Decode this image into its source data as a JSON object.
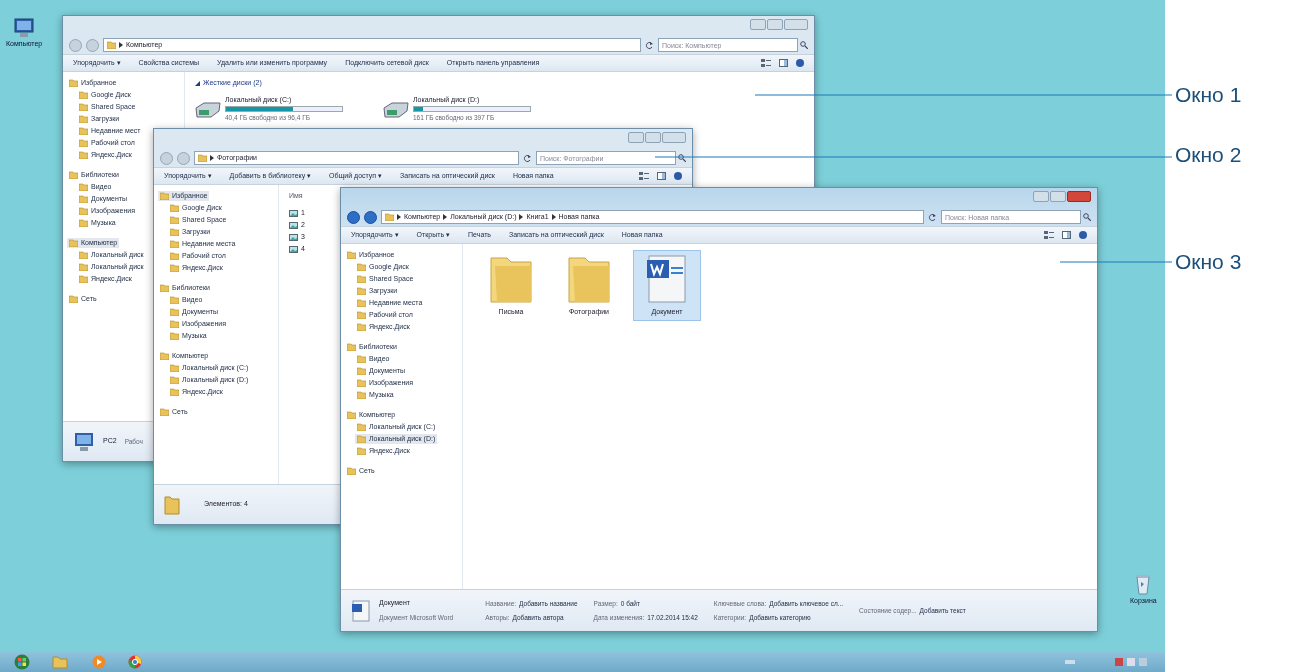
{
  "desktop_icons": [
    {
      "label": "Компьютер"
    },
    {
      "label": "Корзина"
    }
  ],
  "windows": [
    {
      "active": false,
      "crumbs": [
        "Компьютер"
      ],
      "search": {
        "placeholder": "Поиск: Компьютер"
      },
      "toolbar": [
        "Упорядочить ▾",
        "Свойства системы",
        "Удалить или изменить программу",
        "Подключить сетевой диск",
        "Открыть панель управления"
      ],
      "nav": [
        {
          "label": "Избранное",
          "selected": false,
          "children": [
            {
              "label": "Google Диск",
              "selected": false
            },
            {
              "label": "Shared Space",
              "selected": false
            },
            {
              "label": "Загрузки",
              "selected": false
            },
            {
              "label": "Недавние мест",
              "selected": false
            },
            {
              "label": "Рабочий стол",
              "selected": false
            },
            {
              "label": "Яндекс.Диск",
              "selected": false
            }
          ]
        },
        {
          "label": "Библиотеки",
          "selected": false,
          "children": [
            {
              "label": "Видео",
              "selected": false
            },
            {
              "label": "Документы",
              "selected": false
            },
            {
              "label": "Изображения",
              "selected": false
            },
            {
              "label": "Музыка",
              "selected": false
            }
          ]
        },
        {
          "label": "Компьютер",
          "selected": true,
          "children": [
            {
              "label": "Локальный диск",
              "selected": false
            },
            {
              "label": "Локальный диск",
              "selected": false
            },
            {
              "label": "Яндекс.Диск",
              "selected": false
            }
          ]
        },
        {
          "label": "Сеть",
          "selected": false
        }
      ],
      "content": {
        "kind": "drives",
        "heading": "Жесткие диски (2)",
        "items": [
          {
            "name": "Локальный диск (C:)",
            "free": "40,4 ГБ свободно из 96,4 ГБ",
            "level": 0.58
          },
          {
            "name": "Локальный диск (D:)",
            "free": "161 ГБ свободно из 397 ГБ",
            "level": 0.08
          }
        ]
      },
      "status": {
        "kind": "computer",
        "name": "PC2",
        "text": "Рабоч"
      }
    },
    {
      "active": false,
      "crumbs": [
        "Фотографии"
      ],
      "search": {
        "placeholder": "Поиск: Фотографии"
      },
      "toolbar": [
        "Упорядочить ▾",
        "Добавить в библиотеку ▾",
        "Общий доступ ▾",
        "Записать на оптический диск",
        "Новая папка"
      ],
      "nav": [
        {
          "label": "Избранное",
          "selected": true,
          "children": [
            {
              "label": "Google Диск",
              "selected": false
            },
            {
              "label": "Shared Space",
              "selected": false
            },
            {
              "label": "Загрузки",
              "selected": false
            },
            {
              "label": "Недавние места",
              "selected": false
            },
            {
              "label": "Рабочий стол",
              "selected": false
            },
            {
              "label": "Яндекс.Диск",
              "selected": false
            }
          ]
        },
        {
          "label": "Библиотеки",
          "selected": false,
          "children": [
            {
              "label": "Видео",
              "selected": false
            },
            {
              "label": "Документы",
              "selected": false
            },
            {
              "label": "Изображения",
              "selected": false
            },
            {
              "label": "Музыка",
              "selected": false
            }
          ]
        },
        {
          "label": "Компьютер",
          "selected": false,
          "children": [
            {
              "label": "Локальный диск (C:)",
              "selected": false
            },
            {
              "label": "Локальный диск (D:)",
              "selected": false
            },
            {
              "label": "Яндекс.Диск",
              "selected": false
            }
          ]
        },
        {
          "label": "Сеть",
          "selected": false
        }
      ],
      "content": {
        "kind": "list",
        "column": "Имя",
        "items": [
          "1",
          "2",
          "3",
          "4"
        ]
      },
      "status": {
        "kind": "count",
        "text": "Элементов: 4"
      }
    },
    {
      "active": true,
      "crumbs": [
        "Компьютер",
        "Локальный диск (D:)",
        "Книга1",
        "Новая папка"
      ],
      "search": {
        "placeholder": "Поиск: Новая папка"
      },
      "toolbar": [
        "Упорядочить ▾",
        "Открыть ▾",
        "Печать",
        "Записать на оптический диск",
        "Новая папка"
      ],
      "nav": [
        {
          "label": "Избранное",
          "selected": false,
          "children": [
            {
              "label": "Google Диск",
              "selected": false
            },
            {
              "label": "Shared Space",
              "selected": false
            },
            {
              "label": "Загрузки",
              "selected": false
            },
            {
              "label": "Недавние места",
              "selected": false
            },
            {
              "label": "Рабочий стол",
              "selected": false
            },
            {
              "label": "Яндекс.Диск",
              "selected": false
            }
          ]
        },
        {
          "label": "Библиотеки",
          "selected": false,
          "children": [
            {
              "label": "Видео",
              "selected": false
            },
            {
              "label": "Документы",
              "selected": false
            },
            {
              "label": "Изображения",
              "selected": false
            },
            {
              "label": "Музыка",
              "selected": false
            }
          ]
        },
        {
          "label": "Компьютер",
          "selected": false,
          "children": [
            {
              "label": "Локальный диск (C:)",
              "selected": false
            },
            {
              "label": "Локальный диск (D:)",
              "selected": true
            },
            {
              "label": "Яндекс.Диск",
              "selected": false
            }
          ]
        },
        {
          "label": "Сеть",
          "selected": false
        }
      ],
      "content": {
        "kind": "icons",
        "items": [
          {
            "label": "Письма",
            "kind": "folder",
            "selected": false
          },
          {
            "label": "Фотографии",
            "kind": "folder",
            "selected": false
          },
          {
            "label": "Документ",
            "kind": "word",
            "selected": true
          }
        ]
      },
      "status": {
        "kind": "details",
        "name": "Документ",
        "type": "Документ Microsoft Word",
        "props": [
          {
            "label": "Название:",
            "value": "Добавить название"
          },
          {
            "label": "Авторы:",
            "value": "Добавить автора"
          },
          {
            "label": "Размер:",
            "value": "0 байт"
          },
          {
            "label": "Дата изменения:",
            "value": "17.02.2014 15:42"
          },
          {
            "label": "Ключевые слова:",
            "value": "Добавить ключевое сл..."
          },
          {
            "label": "Категории:",
            "value": "Добавить категорию"
          },
          {
            "label": "Состояние содер...",
            "value": "Добавить текст"
          }
        ]
      }
    }
  ],
  "annotations": [
    {
      "label": "Окно 1"
    },
    {
      "label": "Окно 2"
    },
    {
      "label": "Окно 3"
    }
  ]
}
